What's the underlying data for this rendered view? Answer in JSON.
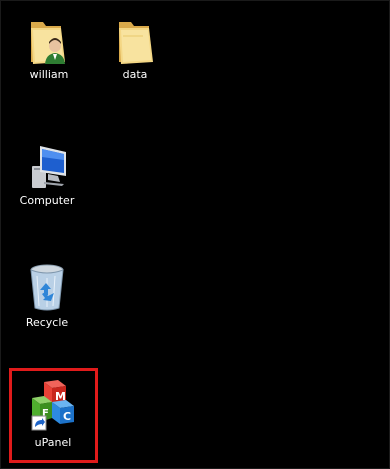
{
  "desktop": {
    "background_color": "#000000",
    "selection_color": "#e01b1b",
    "icons": [
      {
        "label": "william",
        "icon": "user-folder-icon"
      },
      {
        "label": "data",
        "icon": "folder-icon"
      },
      {
        "label": "Computer",
        "icon": "computer-icon"
      },
      {
        "label": "Recycle",
        "icon": "recycle-bin-icon"
      },
      {
        "label": "uPanel",
        "icon": "upanel-mcc-blocks-icon"
      }
    ],
    "selected_icon": "uPanel"
  }
}
